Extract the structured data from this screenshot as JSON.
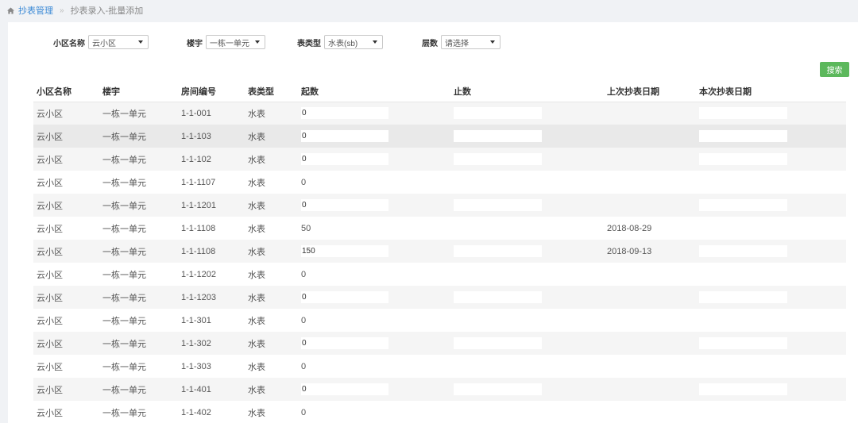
{
  "breadcrumb": {
    "root": "抄表管理",
    "separator": "»",
    "current": "抄表录入-批量添加"
  },
  "filters": [
    {
      "label": "小区名称",
      "value": "云小区"
    },
    {
      "label": "楼宇",
      "value": "一栋一单元"
    },
    {
      "label": "表类型",
      "value": "水表(sb)"
    },
    {
      "label": "层数",
      "value": "请选择"
    }
  ],
  "search_label": "搜索",
  "table": {
    "columns": [
      "小区名称",
      "楼宇",
      "房间编号",
      "表类型",
      "起数",
      "止数",
      "上次抄表日期",
      "本次抄表日期"
    ],
    "rows": [
      {
        "community": "云小区",
        "building": "一栋一单元",
        "room": "1-1-001",
        "meter": "水表",
        "start": "0",
        "end": "",
        "last_date": "",
        "inputs": true
      },
      {
        "community": "云小区",
        "building": "一栋一单元",
        "room": "1-1-103",
        "meter": "水表",
        "start": "0",
        "end": "",
        "last_date": "",
        "inputs": true
      },
      {
        "community": "云小区",
        "building": "一栋一单元",
        "room": "1-1-102",
        "meter": "水表",
        "start": "0",
        "end": "",
        "last_date": "",
        "inputs": true
      },
      {
        "community": "云小区",
        "building": "一栋一单元",
        "room": "1-1-1107",
        "meter": "水表",
        "start": "0",
        "end": "",
        "last_date": "",
        "inputs": false
      },
      {
        "community": "云小区",
        "building": "一栋一单元",
        "room": "1-1-1201",
        "meter": "水表",
        "start": "0",
        "end": "",
        "last_date": "",
        "inputs": true
      },
      {
        "community": "云小区",
        "building": "一栋一单元",
        "room": "1-1-1108",
        "meter": "水表",
        "start": "50",
        "end": "",
        "last_date": "2018-08-29",
        "inputs": false
      },
      {
        "community": "云小区",
        "building": "一栋一单元",
        "room": "1-1-1108",
        "meter": "水表",
        "start": "150",
        "end": "",
        "last_date": "2018-09-13",
        "inputs": true
      },
      {
        "community": "云小区",
        "building": "一栋一单元",
        "room": "1-1-1202",
        "meter": "水表",
        "start": "0",
        "end": "",
        "last_date": "",
        "inputs": false
      },
      {
        "community": "云小区",
        "building": "一栋一单元",
        "room": "1-1-1203",
        "meter": "水表",
        "start": "0",
        "end": "",
        "last_date": "",
        "inputs": true
      },
      {
        "community": "云小区",
        "building": "一栋一单元",
        "room": "1-1-301",
        "meter": "水表",
        "start": "0",
        "end": "",
        "last_date": "",
        "inputs": false
      },
      {
        "community": "云小区",
        "building": "一栋一单元",
        "room": "1-1-302",
        "meter": "水表",
        "start": "0",
        "end": "",
        "last_date": "",
        "inputs": true
      },
      {
        "community": "云小区",
        "building": "一栋一单元",
        "room": "1-1-303",
        "meter": "水表",
        "start": "0",
        "end": "",
        "last_date": "",
        "inputs": false
      },
      {
        "community": "云小区",
        "building": "一栋一单元",
        "room": "1-1-401",
        "meter": "水表",
        "start": "0",
        "end": "",
        "last_date": "",
        "inputs": true
      },
      {
        "community": "云小区",
        "building": "一栋一单元",
        "room": "1-1-402",
        "meter": "水表",
        "start": "0",
        "end": "",
        "last_date": "",
        "inputs": false
      }
    ]
  },
  "icons": {
    "home": "home-icon",
    "caret": "caret-down-icon"
  },
  "colors": {
    "link": "#3b8ad6",
    "button": "#5cb85c",
    "stripe": "#f5f5f5",
    "background": "#f0f2f5"
  }
}
